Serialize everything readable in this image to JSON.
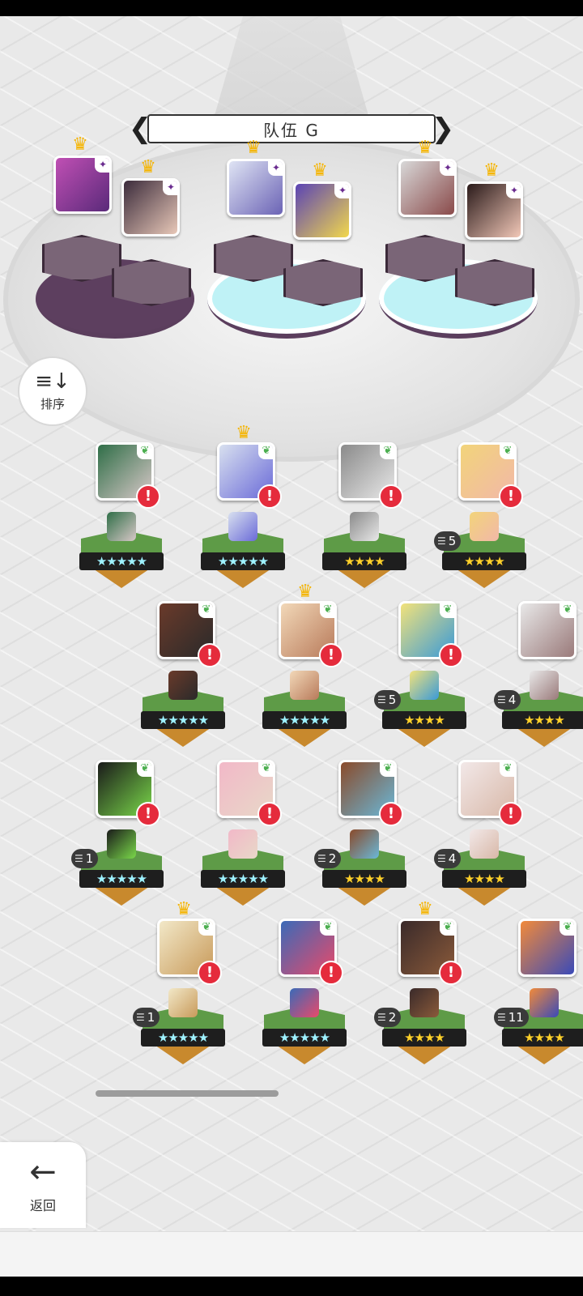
{
  "team": {
    "title": "队伍 G",
    "prev": "❮",
    "next": "❯"
  },
  "sort": {
    "icon": "≡↓",
    "label": "排序"
  },
  "back": {
    "icon": "←",
    "label": "返回"
  },
  "heroes": [
    {
      "stars": "★★★★★",
      "alert": "!",
      "dupe": ""
    },
    {
      "stars": "★★★★★",
      "alert": "!",
      "dupe": ""
    },
    {
      "stars": "★★★★",
      "alert": "!",
      "dupe": ""
    },
    {
      "stars": "★★★★",
      "alert": "!",
      "dupe": "5"
    },
    {
      "stars": "★★★★★",
      "alert": "!",
      "dupe": ""
    },
    {
      "stars": "★★★★★",
      "alert": "!",
      "dupe": ""
    },
    {
      "stars": "★★★★",
      "alert": "!",
      "dupe": "5"
    },
    {
      "stars": "★★★★",
      "alert": "",
      "dupe": "4"
    },
    {
      "stars": "★★★★★",
      "alert": "!",
      "dupe": "1"
    },
    {
      "stars": "★★★★★",
      "alert": "!",
      "dupe": ""
    },
    {
      "stars": "★★★★",
      "alert": "!",
      "dupe": "2"
    },
    {
      "stars": "★★★★",
      "alert": "!",
      "dupe": "4"
    },
    {
      "stars": "★★★★★",
      "alert": "!",
      "dupe": "1"
    },
    {
      "stars": "★★★★★",
      "alert": "!",
      "dupe": ""
    },
    {
      "stars": "★★★★",
      "alert": "!",
      "dupe": "2"
    },
    {
      "stars": "★★★★",
      "alert": "",
      "dupe": "11"
    }
  ],
  "colors": {
    "grass": "#5e9b47",
    "dirt": "#c8892d",
    "alert": "#e52b3c",
    "crown": "#f5b400"
  }
}
